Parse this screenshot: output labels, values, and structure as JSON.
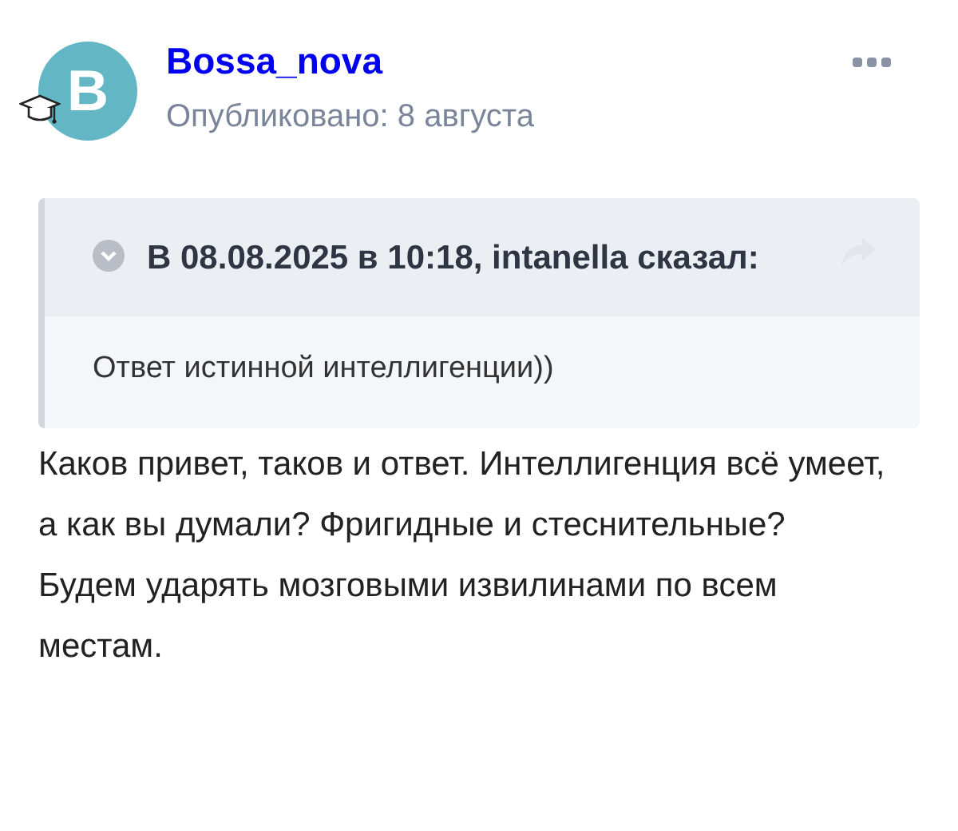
{
  "author": {
    "initial": "B",
    "name": "Bossa_nova",
    "published": "Опубликовано: 8 августа"
  },
  "quote": {
    "expanded": true,
    "header": "В 08.08.2025 в 10:18, intanella сказал:",
    "text": "Ответ истинной интеллигенции))"
  },
  "post": {
    "paragraphs": [
      " Каков привет, таков и ответ. Интеллигенция всё умеет, а как вы думали? Фригидные и стеснительные?",
      "Будем ударять мозговыми извилинами по всем местам."
    ]
  }
}
